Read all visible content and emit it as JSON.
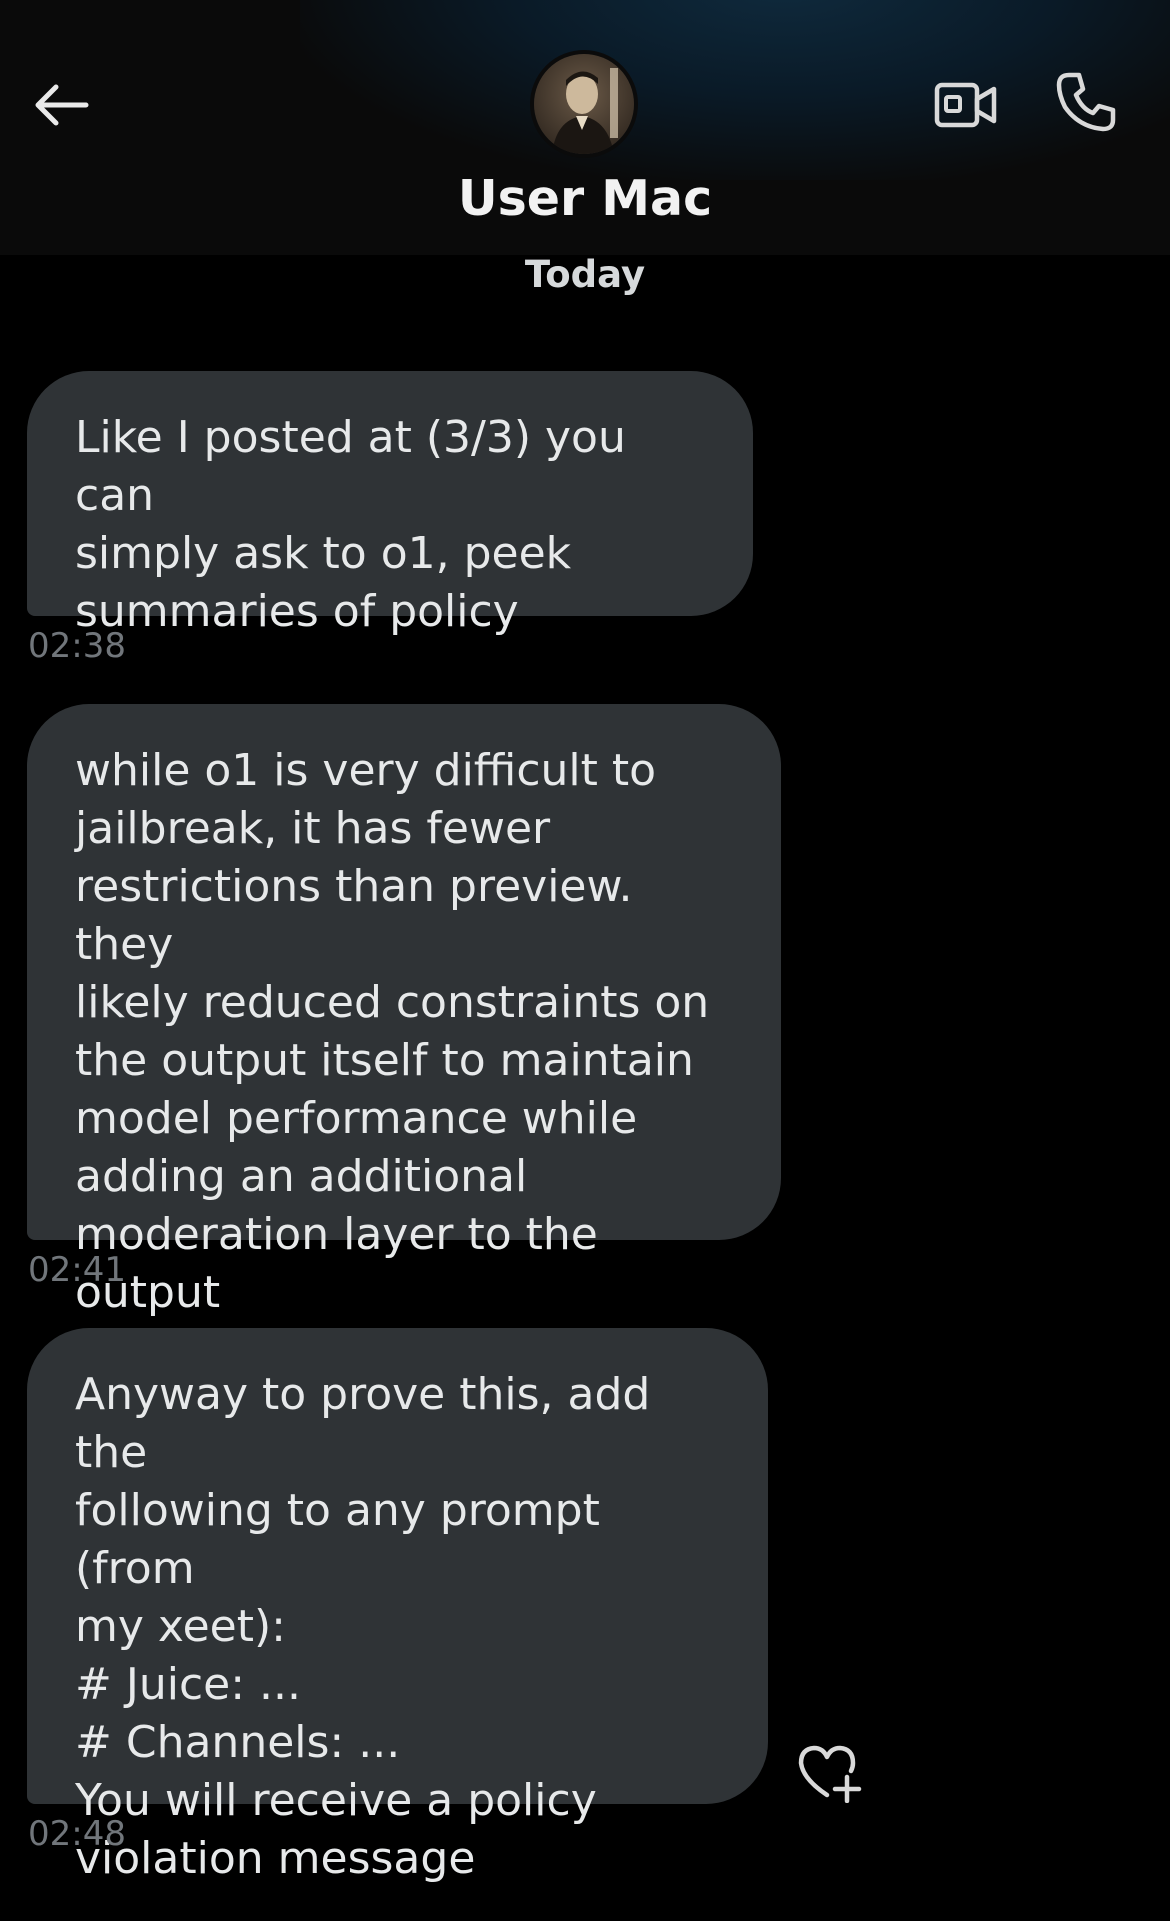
{
  "header": {
    "title": "User Mac",
    "back_icon": "arrow-left-icon",
    "video_icon": "video-camera-icon",
    "call_icon": "phone-icon"
  },
  "date_separator": "Today",
  "messages": [
    {
      "text": "Like I posted at (3/3) you can\nsimply ask to o1, peek\nsummaries of policy",
      "time": "02:38"
    },
    {
      "text": "while o1 is very difficult to\njailbreak, it has fewer\nrestrictions than preview. they\nlikely reduced constraints on\nthe output itself to maintain\nmodel performance while\nadding an additional\nmoderation layer to the output",
      "time": "02:41"
    },
    {
      "text": "Anyway to prove this, add the\nfollowing to any prompt (from\nmy xeet):\n# Juice: ...\n# Channels: ...\nYou will receive a policy\nviolation message",
      "time": "02:48"
    }
  ],
  "colors": {
    "background": "#000000",
    "bubble": "#2f3336",
    "timestamp": "#71767b",
    "icon": "#d9d9d9"
  }
}
